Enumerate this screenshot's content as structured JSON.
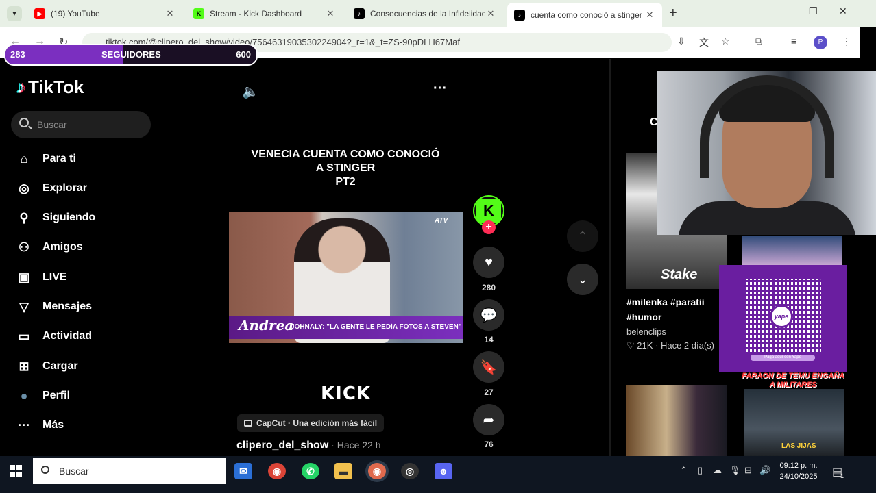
{
  "browser": {
    "tabs": [
      {
        "label": "(19) YouTube",
        "favicon": "youtube-icon",
        "color": "#ff0000"
      },
      {
        "label": "Stream - Kick Dashboard",
        "favicon": "kick-icon",
        "color": "#53fc18"
      },
      {
        "label": "Consecuencias de la Infidelidad",
        "favicon": "tiktok-icon",
        "color": "#000000"
      },
      {
        "label": "cuenta como conoció a stinger",
        "favicon": "tiktok-icon",
        "color": "#000000"
      }
    ],
    "url": "tiktok.com/@clipero_del_show/video/7564631903530224904?_r=1&_t=ZS-90pDLH67Maf",
    "profile_initial": "P"
  },
  "overlay": {
    "followers_current": "283",
    "followers_label": "SEGUIDORES",
    "followers_goal": "600",
    "followers_progress": 0.47
  },
  "tiktok": {
    "logo": "TikTok",
    "search_placeholder": "Buscar",
    "nav": [
      {
        "label": "Para ti",
        "icon": "home-icon",
        "glyph": "⌂"
      },
      {
        "label": "Explorar",
        "icon": "compass-icon",
        "glyph": "◎"
      },
      {
        "label": "Siguiendo",
        "icon": "user-follow-icon",
        "glyph": "⚲"
      },
      {
        "label": "Amigos",
        "icon": "friends-icon",
        "glyph": "⚇"
      },
      {
        "label": "LIVE",
        "icon": "live-tv-icon",
        "glyph": "▣"
      },
      {
        "label": "Mensajes",
        "icon": "paper-plane-icon",
        "glyph": "▽"
      },
      {
        "label": "Actividad",
        "icon": "activity-icon",
        "glyph": "▭"
      },
      {
        "label": "Cargar",
        "icon": "upload-plus-icon",
        "glyph": "⊞"
      },
      {
        "label": "Perfil",
        "icon": "profile-avatar-icon",
        "glyph": "●"
      },
      {
        "label": "Más",
        "icon": "more-dots-icon",
        "glyph": "···"
      }
    ]
  },
  "video": {
    "title_lines": [
      "VENECIA CUENTA COMO CONOCIÓ",
      "A STINGER",
      "PT2"
    ],
    "overlay_name": "Andrea",
    "overlay_caption": "JOHNALY: \"LA GENTE LE PEDÍA FOTOS A STEVEN\"",
    "channel_bug": "ATV",
    "kick_text": "KICK",
    "capcut_label": "CapCut · Una edición más fácil",
    "author": "clipero_del_show",
    "time_ago": " · Hace 22 h",
    "likes": "280",
    "comments": "14",
    "saves": "27",
    "shares": "76"
  },
  "right_feed": {
    "header_initial": "C",
    "stake_text": "Stake",
    "hashtags": "#milenka #paratii\n#humor",
    "user": "belenclips",
    "meta": "♡ 21K · Hace 2 día(s)",
    "qr_label": "yape",
    "qr_pay": "Paga aquí con Yape",
    "promo_text": "FARAON DE TEMU ENGAÑA A MILITARES",
    "promo_tag": "LAS JIJAS"
  },
  "taskbar": {
    "search_placeholder": "Buscar",
    "time": "09:12 p. m.",
    "date": "24/10/2025",
    "notif_count": "1"
  }
}
